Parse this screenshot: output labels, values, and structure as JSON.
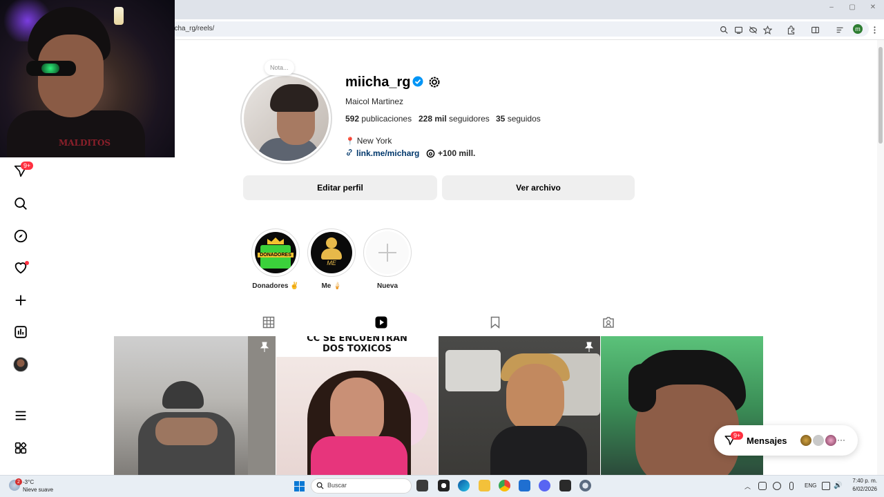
{
  "browser": {
    "url": "iicha_rg/reels/"
  },
  "note": {
    "label": "Nota..."
  },
  "profile": {
    "username": "miicha_rg",
    "full_name": "Maicol Martinez",
    "stats": {
      "posts_value": "592",
      "posts_label": "publicaciones",
      "followers_value": "228 mil",
      "followers_label": "seguidores",
      "following_value": "35",
      "following_label": "seguidos"
    },
    "location": "New York",
    "link": "link.me/micharg",
    "threads": "+100 mill."
  },
  "buttons": {
    "edit": "Editar perfil",
    "archive": "Ver archivo"
  },
  "highlights": [
    {
      "label": "Donadores ✌️",
      "badge_text": "DONADORES"
    },
    {
      "label": "Me 🍦",
      "badge_text": "ME"
    },
    {
      "label": "Nueva"
    }
  ],
  "nav": {
    "badge": "9+"
  },
  "tiles": [
    {
      "caption": "",
      "pinned": true,
      "overlay": ""
    },
    {
      "caption": "CC SE ENCUENTRAN\nDOS TOXICOS",
      "pinned": false
    },
    {
      "caption": "",
      "pinned": true
    },
    {
      "caption": "",
      "pinned": false
    }
  ],
  "messages": {
    "label": "Mensajes",
    "badge": "9+"
  },
  "taskbar": {
    "weather_badge": "2",
    "temp": "-3°C",
    "weather_desc": "Nieve suave",
    "search": "Buscar",
    "lang": "ENG",
    "time": "7:40 p. m.",
    "date": "6/02/2026"
  },
  "colors": {
    "accent_link": "#00376b",
    "verified": "#0095f6",
    "badge_red": "#ff3040",
    "button_bg": "#efefef"
  }
}
